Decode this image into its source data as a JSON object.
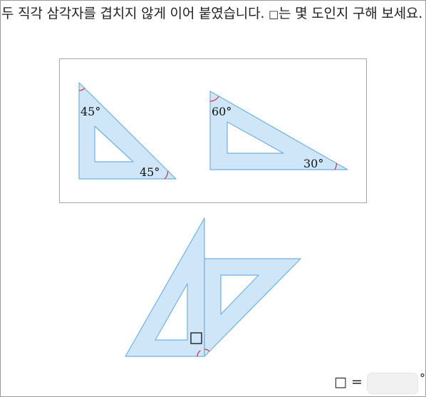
{
  "question": {
    "text": "두 직각 삼각자를 겹치지 않게 이어 붙였습니다. ",
    "symbol": "□",
    "text2": "는 몇 도인지 구해 보세요."
  },
  "reference": {
    "triangle_45": {
      "angle_top": "45°",
      "angle_bottom": "45°"
    },
    "triangle_30_60": {
      "angle_left": "60°",
      "angle_right": "30°"
    }
  },
  "answer": {
    "symbol": "□ =",
    "value": "",
    "unit": "°"
  },
  "colors": {
    "fill": "#cfe6f9",
    "stroke": "#6fb1e3",
    "arc": "#e0243a",
    "border": "#a8a8a8"
  }
}
